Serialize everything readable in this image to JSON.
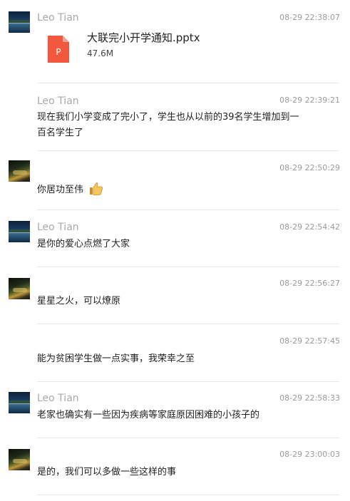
{
  "messages": [
    {
      "sender": "Leo Tian",
      "time": "08-29 22:38:07",
      "file": {
        "icon": "ppt-file-icon",
        "icon_letter": "P",
        "name": "大联完小开学通知.pptx",
        "size": "47.6M",
        "color": "#f2583e"
      }
    },
    {
      "sender": "Leo Tian",
      "time": "08-29 22:39:21",
      "text_line1": "现在我们小学变成了完小了，学生也从以前的39名学生增加到一",
      "text_line2": "百名学生了"
    },
    {
      "sender": "",
      "time": "08-29 22:50:29",
      "text": "你居功至伟",
      "emoji": "thumbs-up-emoji"
    },
    {
      "sender": "Leo Tian",
      "time": "08-29 22:54:42",
      "text": "是你的爱心点燃了大家"
    },
    {
      "sender": "",
      "time": "08-29 22:56:27",
      "text": "星星之火，可以燎原"
    },
    {
      "sender": "",
      "time": "08-29 22:57:45",
      "text": "能为贫困学生做一点实事，我荣幸之至"
    },
    {
      "sender": "Leo Tian",
      "time": "08-29 22:58:33",
      "text": "老家也确实有一些因为疾病等家庭原因困难的小孩子的"
    },
    {
      "sender": "",
      "time": "08-29 23:00:03",
      "text": "是的，我们可以多做一些这样的事"
    }
  ],
  "colors": {
    "sender_name": "#a9a9a9",
    "timestamp": "#9a9a9a",
    "divider": "#e6e6e6",
    "ppt_icon": "#f2583e"
  }
}
